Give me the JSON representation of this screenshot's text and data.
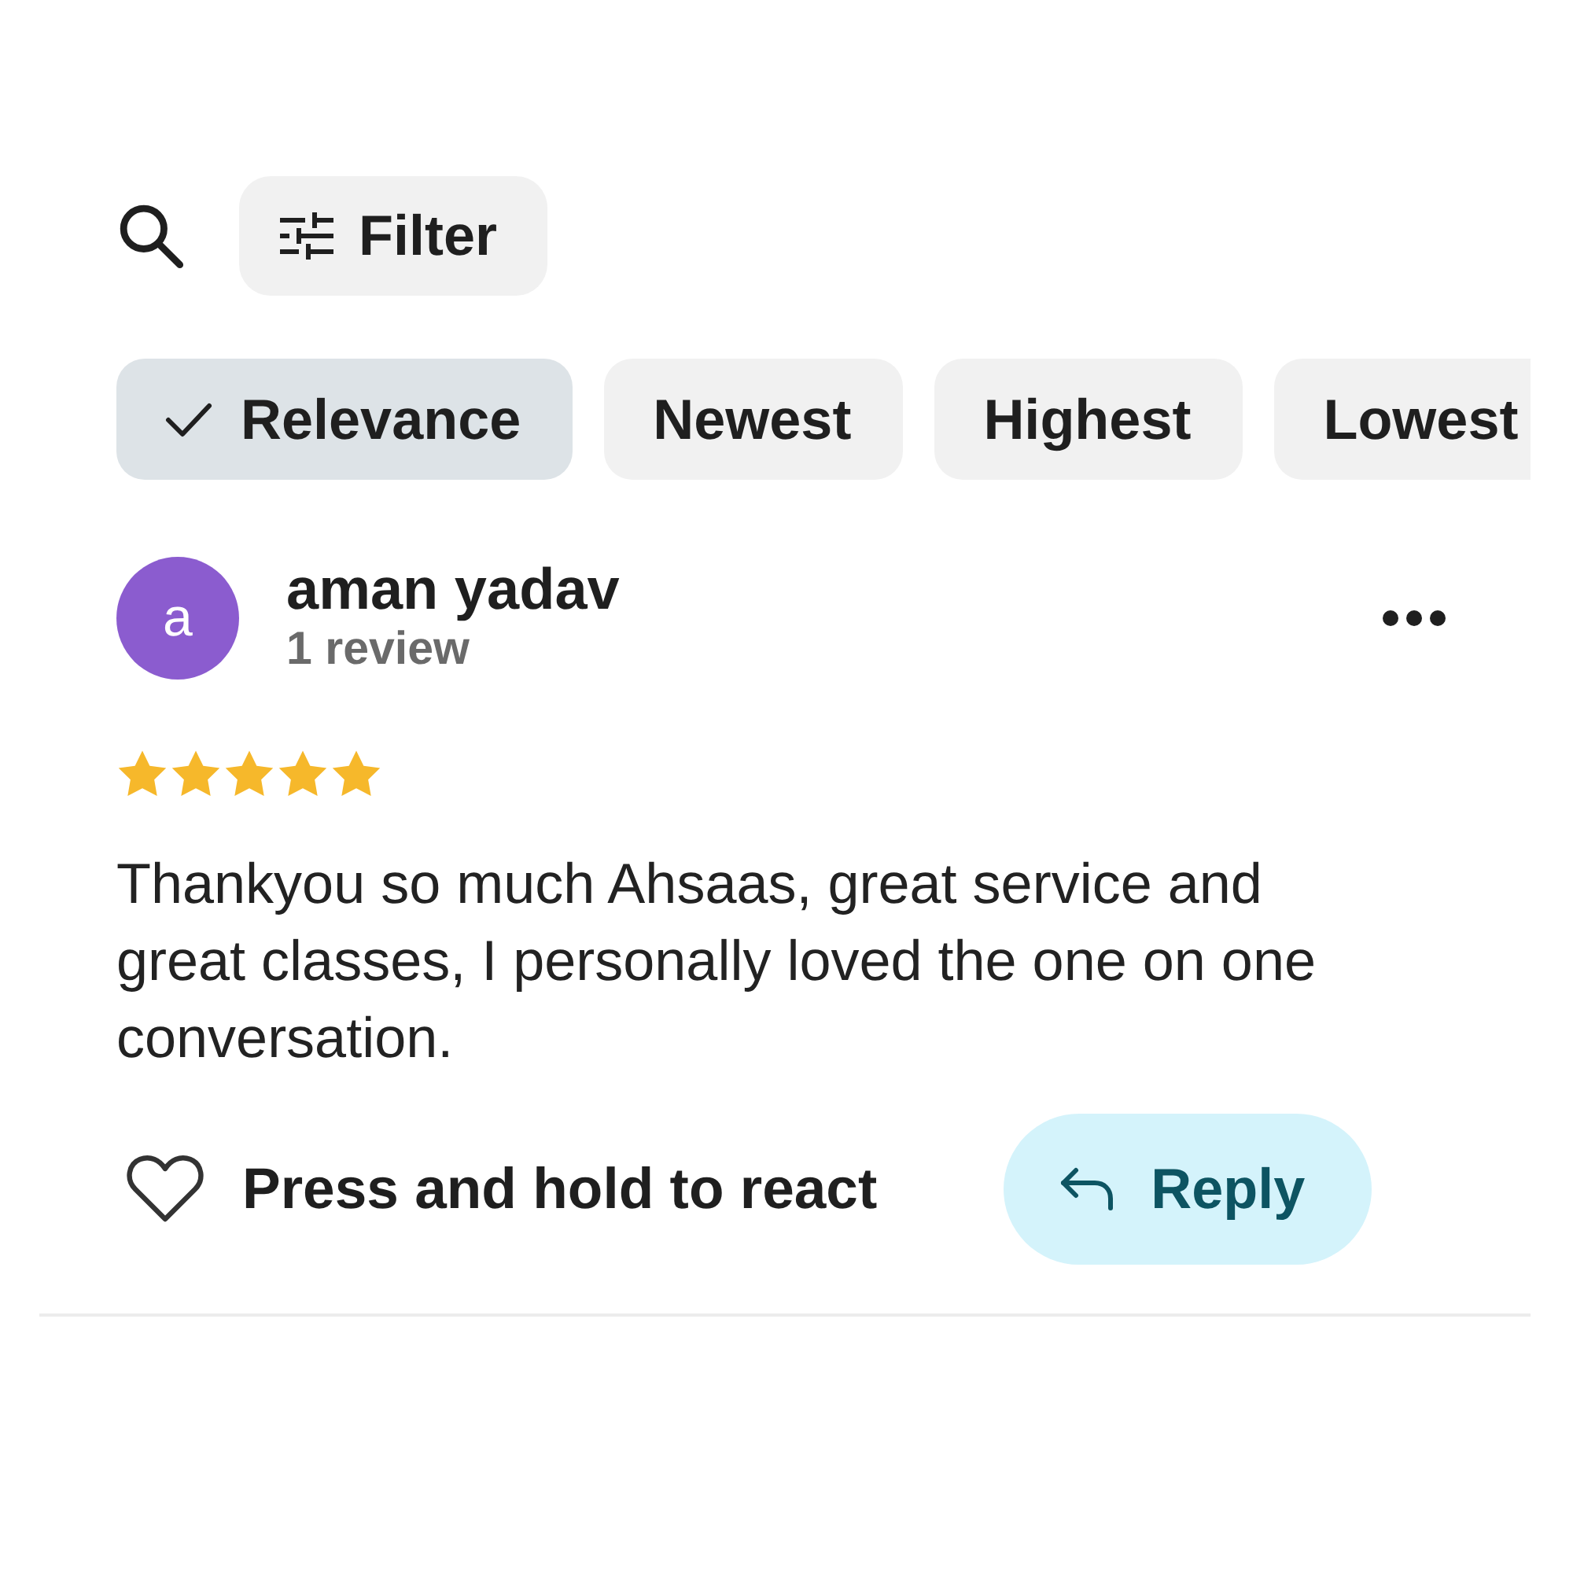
{
  "toolbar": {
    "filter_button": {
      "label": "Filter"
    }
  },
  "sort_options": [
    {
      "label": "Relevance",
      "selected": true
    },
    {
      "label": "Newest",
      "selected": false
    },
    {
      "label": "Highest",
      "selected": false
    },
    {
      "label": "Lowest",
      "selected": false
    }
  ],
  "review": {
    "avatar_letter": "a",
    "author": "aman yadav",
    "author_meta": "1 review",
    "stars": 5,
    "text": "Thankyou so much Ahsaas, great service and great classes, I personally loved the one on one conversation.",
    "react_hint": "Press and hold to react",
    "reply_button": {
      "label": "Reply"
    }
  }
}
